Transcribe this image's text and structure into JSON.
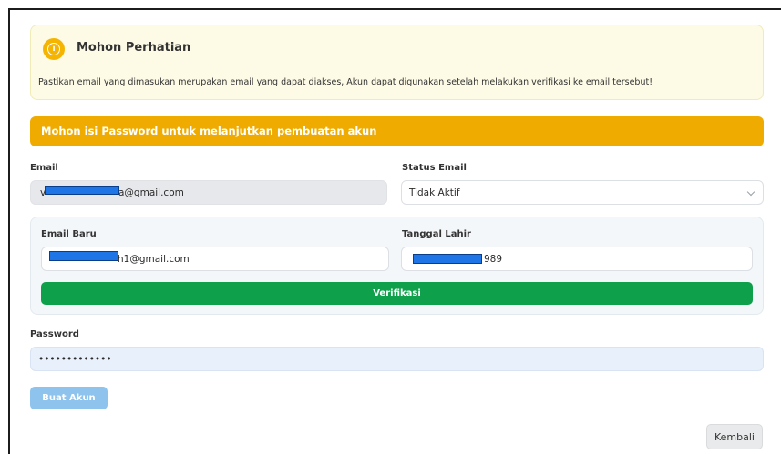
{
  "notice": {
    "icon": "info-icon",
    "icon_glyph": "i",
    "title": "Mohon Perhatian",
    "text": "Pastikan email yang dimasukan merupakan email yang dapat diakses, Akun dapat digunakan setelah melakukan verifikasi ke email tersebut!"
  },
  "warning": {
    "text": "Mohon isi Password untuk melanjutkan pembuatan akun"
  },
  "form": {
    "email_label": "Email",
    "email_value_prefix": "v",
    "email_value_suffix": "a@gmail.com",
    "status_label": "Status Email",
    "status_value": "Tidak Aktif",
    "new_email_label": "Email Baru",
    "new_email_value_suffix": "h1@gmail.com",
    "birth_date_label": "Tanggal Lahir",
    "birth_date_value_suffix": "989",
    "verify_label": "Verifikasi",
    "password_label": "Password",
    "password_value": "•••••••••••••",
    "create_label": "Buat Akun",
    "back_label": "Kembali"
  },
  "colors": {
    "accent_warning": "#f0ab00",
    "verify_green": "#0ea04a",
    "create_blue": "#8dc3ec",
    "redaction_blue": "#1f74e6"
  }
}
